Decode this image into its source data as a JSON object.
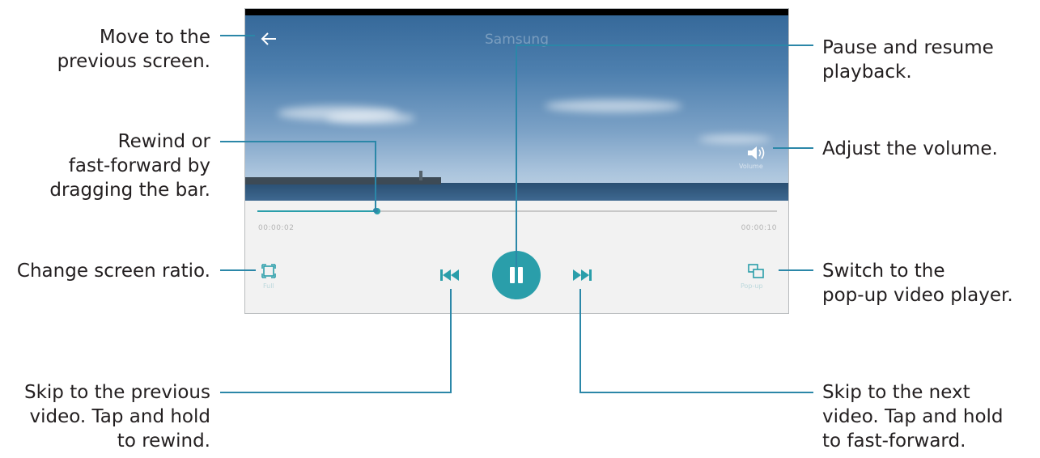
{
  "player": {
    "video_title": "Samsung",
    "time_current": "00:00:02",
    "time_total": "00:00:10",
    "progress_fraction": 0.23,
    "ratio_label": "Full",
    "popup_label": "Pop-up",
    "volume_label": "Volume",
    "icons": [
      "back-arrow-icon",
      "volume-icon",
      "screen-ratio-icon",
      "previous-track-icon",
      "pause-icon",
      "next-track-icon",
      "popup-player-icon"
    ]
  },
  "annotations": {
    "back": [
      "Move to the",
      "previous screen."
    ],
    "seek": [
      "Rewind or",
      "fast-forward by",
      "dragging the bar."
    ],
    "ratio": [
      "Change screen ratio."
    ],
    "prev": [
      "Skip to the previous",
      "video. Tap and hold",
      "to rewind."
    ],
    "pause": [
      "Pause and resume",
      "playback."
    ],
    "volume": [
      "Adjust the volume."
    ],
    "popup": [
      "Switch to the",
      "pop-up video player."
    ],
    "next": [
      "Skip to the next",
      "video. Tap and hold",
      "to fast-forward."
    ]
  },
  "colors": {
    "accent": "#2a9eaa",
    "callout_line": "#2b87a8",
    "text": "#231f20"
  }
}
